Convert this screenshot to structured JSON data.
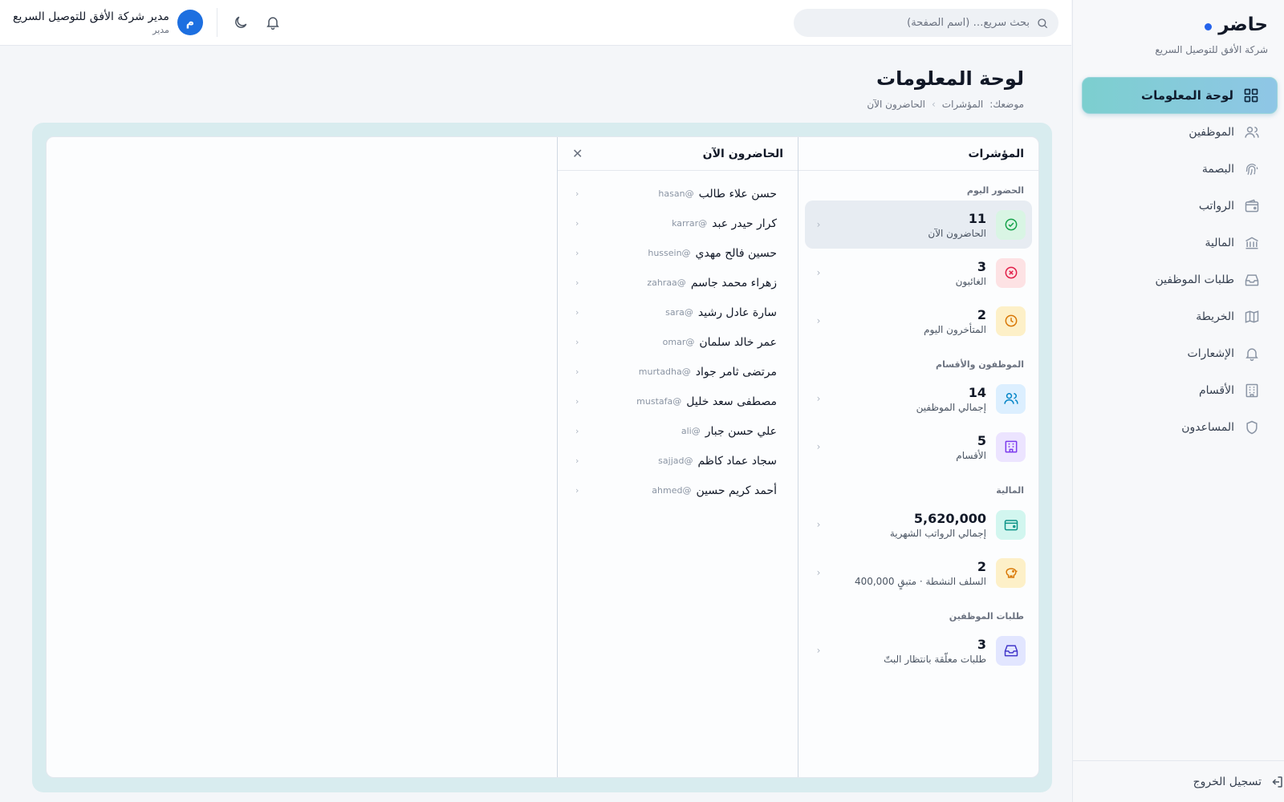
{
  "brand": {
    "name": "حاضر",
    "company": "شركة الأفق للتوصيل السريع"
  },
  "sidebar": {
    "items": [
      {
        "label": "لوحة المعلومات",
        "icon": "dashboard-icon",
        "active": true
      },
      {
        "label": "الموظفين",
        "icon": "users-icon"
      },
      {
        "label": "البصمة",
        "icon": "fingerprint-icon"
      },
      {
        "label": "الرواتب",
        "icon": "wallet-icon"
      },
      {
        "label": "المالية",
        "icon": "bank-icon"
      },
      {
        "label": "طلبات الموظفين",
        "icon": "inbox-icon"
      },
      {
        "label": "الخريطة",
        "icon": "map-icon"
      },
      {
        "label": "الإشعارات",
        "icon": "bell-icon"
      },
      {
        "label": "الأقسام",
        "icon": "building-icon"
      },
      {
        "label": "المساعدون",
        "icon": "shield-icon"
      }
    ],
    "logout": "تسجيل الخروج"
  },
  "topbar": {
    "search_placeholder": "بحث سريع… (اسم الصفحة)",
    "user_name": "مدير شركة الأفق للتوصيل السريع",
    "user_role": "مدير",
    "avatar_letter": "م"
  },
  "page": {
    "title": "لوحة المعلومات",
    "breadcrumb": {
      "prefix": "موضعك:",
      "items": [
        "المؤشرات",
        "الحاضرون الآن"
      ]
    }
  },
  "indicators": {
    "title": "المؤشرات",
    "sections": [
      {
        "label": "الحضور اليوم",
        "stats": [
          {
            "value": "11",
            "label": "الحاضرون الآن",
            "icon": "check-circle-icon",
            "active": true
          },
          {
            "value": "3",
            "label": "الغائبون",
            "icon": "x-circle-icon"
          },
          {
            "value": "2",
            "label": "المتأخرون اليوم",
            "icon": "clock-icon"
          }
        ]
      },
      {
        "label": "الموظفون والأقسام",
        "stats": [
          {
            "value": "14",
            "label": "إجمالي الموظفين",
            "icon": "users-icon"
          },
          {
            "value": "5",
            "label": "الأقسام",
            "icon": "building-icon"
          }
        ]
      },
      {
        "label": "المالية",
        "stats": [
          {
            "value": "5,620,000",
            "label": "إجمالي الرواتب الشهرية",
            "icon": "wallet-icon"
          },
          {
            "value": "2",
            "label": "السلف النشطة · متبقٍ 400,000",
            "icon": "piggy-bank-icon"
          }
        ]
      },
      {
        "label": "طلبات الموظفين",
        "stats": [
          {
            "value": "3",
            "label": "طلبات معلّقة بانتظار البتّ",
            "icon": "inbox-icon"
          }
        ]
      }
    ]
  },
  "present": {
    "title": "الحاضرون الآن",
    "people": [
      {
        "name": "حسن علاء طالب",
        "username": "hasan@"
      },
      {
        "name": "كرار حيدر عبد",
        "username": "karrar@"
      },
      {
        "name": "حسين فالح مهدي",
        "username": "hussein@"
      },
      {
        "name": "زهراء محمد جاسم",
        "username": "zahraa@"
      },
      {
        "name": "سارة عادل رشيد",
        "username": "sara@"
      },
      {
        "name": "عمر خالد سلمان",
        "username": "omar@"
      },
      {
        "name": "مرتضى ثامر جواد",
        "username": "murtadha@"
      },
      {
        "name": "مصطفى سعد خليل",
        "username": "mustafa@"
      },
      {
        "name": "علي حسن جبار",
        "username": "ali@"
      },
      {
        "name": "سجاد عماد كاظم",
        "username": "sajjad@"
      },
      {
        "name": "أحمد كريم حسين",
        "username": "ahmed@"
      }
    ]
  },
  "colors": {
    "accent": "#2563eb",
    "active_nav_from": "#7ccfcf",
    "active_nav_to": "#8fc6e6",
    "badge_green": "#d9f5e4",
    "badge_red": "#fde2e4",
    "badge_amber": "#fdf0c8",
    "badge_blue": "#dcefff",
    "badge_purple": "#ece4ff",
    "badge_teal": "#d2f6ef",
    "badge_indigo": "#e2e6ff"
  }
}
